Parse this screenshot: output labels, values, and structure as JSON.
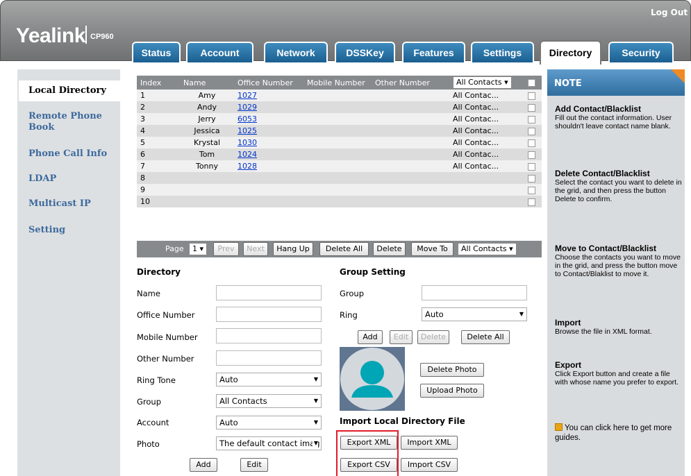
{
  "brand": {
    "logo": "Yealink",
    "model": "CP960"
  },
  "header": {
    "logout": "Log Out"
  },
  "tabs": [
    {
      "label": "Status"
    },
    {
      "label": "Account"
    },
    {
      "label": "Network"
    },
    {
      "label": "DSSKey"
    },
    {
      "label": "Features"
    },
    {
      "label": "Settings"
    },
    {
      "label": "Directory",
      "active": true
    },
    {
      "label": "Security"
    }
  ],
  "leftnav": {
    "title": "Local Directory",
    "items": [
      {
        "label": "Remote Phone\nBook"
      },
      {
        "label": "Phone Call Info"
      },
      {
        "label": "LDAP"
      },
      {
        "label": "Multicast IP"
      },
      {
        "label": "Setting"
      }
    ]
  },
  "grid": {
    "headers": [
      "Index",
      "Name",
      "Office Number",
      "Mobile Number",
      "Other Number"
    ],
    "filter": "All Contacts",
    "rows": [
      {
        "index": "1",
        "name": "Amy",
        "office": "1027",
        "group": "All Contac..."
      },
      {
        "index": "2",
        "name": "Andy",
        "office": "1029",
        "group": "All Contac..."
      },
      {
        "index": "3",
        "name": "Jerry",
        "office": "6053",
        "group": "All Contac..."
      },
      {
        "index": "4",
        "name": "Jessica",
        "office": "1025",
        "group": "All Contac..."
      },
      {
        "index": "5",
        "name": "Krystal",
        "office": "1030",
        "group": "All Contac..."
      },
      {
        "index": "6",
        "name": "Tom",
        "office": "1024",
        "group": "All Contac..."
      },
      {
        "index": "7",
        "name": "Tonny",
        "office": "1028",
        "group": "All Contac..."
      },
      {
        "index": "8",
        "name": "",
        "office": "",
        "group": ""
      },
      {
        "index": "9",
        "name": "",
        "office": "",
        "group": ""
      },
      {
        "index": "10",
        "name": "",
        "office": "",
        "group": ""
      }
    ]
  },
  "pager": {
    "page_label": "Page",
    "page": "1",
    "prev": "Prev",
    "next": "Next",
    "hangup": "Hang Up",
    "delete_all": "Delete All",
    "delete": "Delete",
    "move_to": "Move To",
    "move_target": "All Contacts"
  },
  "directory": {
    "title": "Directory",
    "name": "Name",
    "office": "Office Number",
    "mobile": "Mobile Number",
    "other": "Other Number",
    "ring_tone": "Ring Tone",
    "ring_tone_value": "Auto",
    "group": "Group",
    "group_value": "All Contacts",
    "account": "Account",
    "account_value": "Auto",
    "photo": "Photo",
    "photo_value": "The default contact imag",
    "add": "Add",
    "edit": "Edit"
  },
  "group_setting": {
    "title": "Group Setting",
    "group": "Group",
    "ring": "Ring",
    "ring_value": "Auto",
    "add": "Add",
    "edit": "Edit",
    "delete": "Delete",
    "delete_all": "Delete All",
    "delete_photo": "Delete Photo",
    "upload_photo": "Upload Photo"
  },
  "import": {
    "title": "Import Local Directory File",
    "export_xml": "Export XML",
    "import_xml": "Import XML",
    "export_csv": "Export CSV",
    "import_csv": "Import CSV"
  },
  "note": {
    "title": "NOTE",
    "sections": [
      {
        "head": "Add Contact/Blacklist",
        "text": "Fill out the contact information. User shouldn't leave contact name blank."
      },
      {
        "head": "Delete Contact/Blacklist",
        "text": "Select the contact you want to delete in the grid, and then press the button Delete to confirm."
      },
      {
        "head": "Move to Contact/Blacklist",
        "text": "Choose the contacts you want to move in the grid, and press the button move to Contact/Blaklist to move it."
      },
      {
        "head": "Import",
        "text": "Browse the file in XML format."
      },
      {
        "head": "Export",
        "text": "Click Export button and create a file with whose name you prefer to export."
      }
    ],
    "guide": "You can click here to get more guides."
  },
  "colors": {
    "header": "#8e8f90",
    "tab": "#1b5f90",
    "nav": "#3d6a9e",
    "highlight": "#e01c2a",
    "note_corner": "#f08a24"
  }
}
